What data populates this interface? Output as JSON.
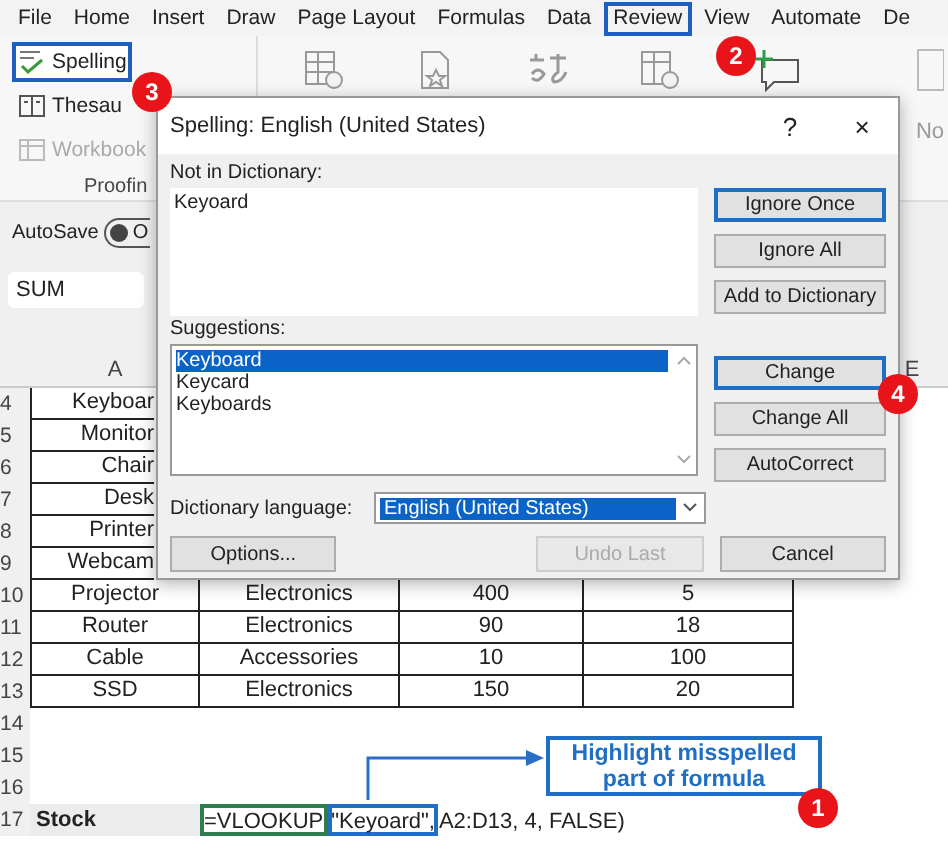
{
  "ribbon_tabs": [
    {
      "label": "File",
      "selected": false
    },
    {
      "label": "Home",
      "selected": false
    },
    {
      "label": "Insert",
      "selected": false
    },
    {
      "label": "Draw",
      "selected": false
    },
    {
      "label": "Page Layout",
      "selected": false
    },
    {
      "label": "Formulas",
      "selected": false
    },
    {
      "label": "Data",
      "selected": false
    },
    {
      "label": "Review",
      "selected": true
    },
    {
      "label": "View",
      "selected": false
    },
    {
      "label": "Automate",
      "selected": false
    },
    {
      "label": "De",
      "selected": false
    }
  ],
  "proofing": {
    "buttons": [
      {
        "label": "Spelling",
        "kind": "spelling",
        "disabled": false,
        "highlighted": true
      },
      {
        "label": "Thesau",
        "kind": "thesaurus",
        "disabled": false,
        "highlighted": false
      },
      {
        "label": "Workbook",
        "kind": "workbook",
        "disabled": true,
        "highlighted": false
      }
    ],
    "group_label": "Proofin"
  },
  "ribbon_cut_label": "No",
  "autosave": {
    "label": "AutoSave",
    "toggle_text": "O",
    "on": false
  },
  "name_box": "SUM",
  "column_headers": [
    "A",
    "E"
  ],
  "rows": [
    {
      "number": "4",
      "kind": "data",
      "cells": [
        "Keyboar"
      ]
    },
    {
      "number": "5",
      "kind": "data",
      "cells": [
        "Monitor"
      ]
    },
    {
      "number": "6",
      "kind": "data",
      "cells": [
        "Chair"
      ]
    },
    {
      "number": "7",
      "kind": "data",
      "cells": [
        "Desk"
      ]
    },
    {
      "number": "8",
      "kind": "data",
      "cells": [
        "Printer"
      ]
    },
    {
      "number": "9",
      "kind": "data",
      "cells": [
        "Webcam"
      ]
    },
    {
      "number": "10",
      "kind": "data",
      "cells": [
        "Projector",
        "Electronics",
        "400",
        "5"
      ]
    },
    {
      "number": "11",
      "kind": "data",
      "cells": [
        "Router",
        "Electronics",
        "90",
        "18"
      ]
    },
    {
      "number": "12",
      "kind": "data",
      "cells": [
        "Cable",
        "Accessories",
        "10",
        "100"
      ]
    },
    {
      "number": "13",
      "kind": "data",
      "cells": [
        "SSD",
        "Electronics",
        "150",
        "20"
      ]
    },
    {
      "number": "14",
      "kind": "empty"
    },
    {
      "number": "15",
      "kind": "empty"
    },
    {
      "number": "16",
      "kind": "empty"
    },
    {
      "number": "17",
      "kind": "formula",
      "label": "Stock",
      "formula_parts": [
        {
          "text": "=VLOOKUP",
          "kind": "function"
        },
        {
          "text": "\"Keyoard\",",
          "kind": "misspelled"
        },
        {
          "text": " A2:D13, 4, FALSE)",
          "kind": "plain"
        }
      ]
    }
  ],
  "dialog": {
    "title": "Spelling: English (United States)",
    "help": "?",
    "close": "×",
    "not_in_dictionary_label": "Not in Dictionary:",
    "not_in_dictionary_value": "Keyoard",
    "suggestions_label": "Suggestions:",
    "suggestions": [
      {
        "text": "Keyboard",
        "selected": true
      },
      {
        "text": "Keycard",
        "selected": false
      },
      {
        "text": "Keyboards",
        "selected": false
      }
    ],
    "dictionary_language_label": "Dictionary language:",
    "dictionary_language_value": "English (United States)",
    "top_buttons": [
      {
        "label": "Ignore Once",
        "focused": true,
        "disabled": false
      },
      {
        "label": "Ignore All",
        "focused": false,
        "disabled": false
      },
      {
        "label": "Add to Dictionary",
        "focused": false,
        "disabled": false
      }
    ],
    "middle_buttons": [
      {
        "label": "Change",
        "focused": true,
        "disabled": false
      },
      {
        "label": "Change All",
        "focused": false,
        "disabled": false
      },
      {
        "label": "AutoCorrect",
        "focused": false,
        "disabled": false
      }
    ],
    "bottom_buttons": [
      {
        "label": "Options...",
        "focused": false,
        "disabled": false
      },
      {
        "label": "Undo Last",
        "focused": false,
        "disabled": true
      },
      {
        "label": "Cancel",
        "focused": false,
        "disabled": false
      }
    ]
  },
  "step_badges": [
    "1",
    "2",
    "3",
    "4"
  ],
  "callout": "Highlight misspelled part of formula"
}
